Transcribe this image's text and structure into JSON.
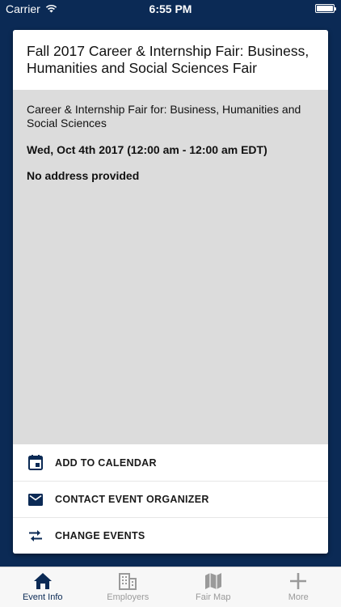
{
  "status_bar": {
    "carrier": "Carrier",
    "time": "6:55 PM"
  },
  "event": {
    "title": "Fall 2017 Career & Internship Fair: Business, Humanities and Social Sciences Fair",
    "subtitle": "Career & Internship Fair for: Business, Humanities and Social Sciences",
    "date": "Wed, Oct 4th 2017 (12:00 am - 12:00 am EDT)",
    "address": "No address provided"
  },
  "actions": [
    {
      "label": "ADD TO CALENDAR",
      "icon": "calendar-icon"
    },
    {
      "label": "CONTACT EVENT ORGANIZER",
      "icon": "envelope-icon"
    },
    {
      "label": "CHANGE EVENTS",
      "icon": "swap-arrows-icon"
    }
  ],
  "tabs": [
    {
      "label": "Event Info",
      "icon": "home-icon",
      "active": true
    },
    {
      "label": "Employers",
      "icon": "building-icon",
      "active": false
    },
    {
      "label": "Fair Map",
      "icon": "map-icon",
      "active": false
    },
    {
      "label": "More",
      "icon": "plus-icon",
      "active": false
    }
  ],
  "colors": {
    "brand": "#0b2a55",
    "card_body": "#dcdcdc",
    "tab_inactive": "#9a9a9a"
  }
}
